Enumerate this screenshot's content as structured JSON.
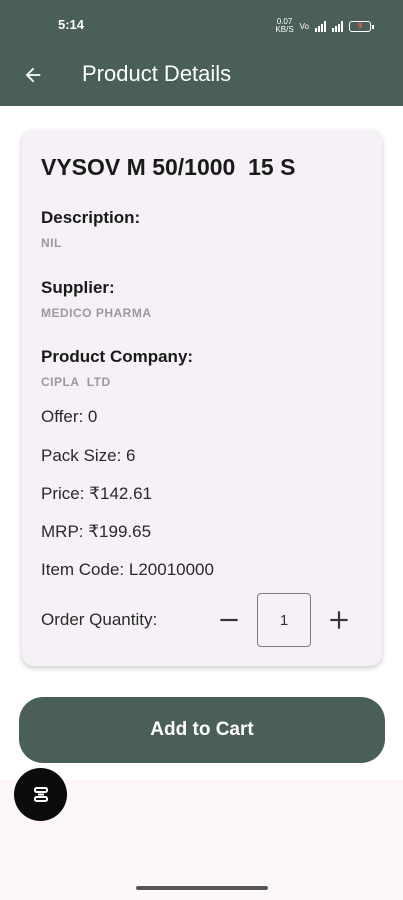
{
  "status_bar": {
    "time": "5:14",
    "speed_value": "0.07",
    "speed_unit": "KB/S",
    "battery": "9"
  },
  "header": {
    "title": "Product Details"
  },
  "product": {
    "name": "VYSOV M 50/1000  15 S",
    "description_label": "Description:",
    "description_value": "NIL",
    "supplier_label": "Supplier:",
    "supplier_value": "MEDICO PHARMA",
    "company_label": "Product Company:",
    "company_value": "CIPLA  LTD",
    "offer": "Offer: 0",
    "pack_size": "Pack Size: 6",
    "price": "Price: ₹142.61",
    "mrp": "MRP: ₹199.65",
    "item_code": "Item Code: L20010000",
    "order_quantity_label": "Order Quantity:",
    "order_quantity_value": "1"
  },
  "actions": {
    "add_to_cart": "Add to Cart"
  },
  "colors": {
    "primary": "#4a5f57",
    "card_bg": "#f5f1f6"
  }
}
